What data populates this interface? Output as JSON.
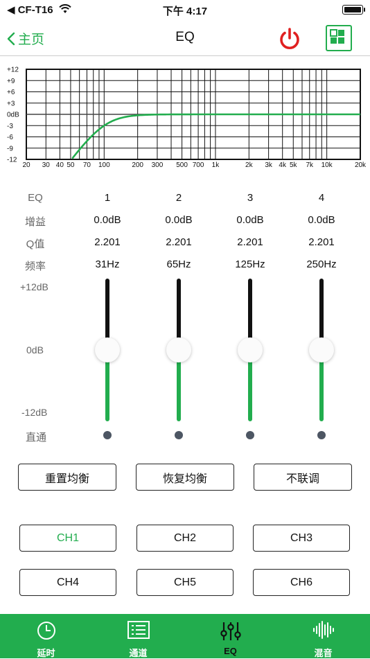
{
  "status_bar": {
    "carrier": "CF-T16",
    "time": "下午 4:17"
  },
  "nav": {
    "back_label": "主页",
    "title": "EQ"
  },
  "graph": {
    "y_ticks": [
      "+12",
      "+9",
      "+6",
      "+3",
      "0dB",
      "-3",
      "-6",
      "-9",
      "-12"
    ],
    "x_ticks": [
      "20",
      "30",
      "40",
      "50",
      "70",
      "100",
      "200",
      "300",
      "500",
      "700",
      "1k",
      "2k",
      "3k",
      "4k",
      "5k",
      "7k",
      "10k",
      "20k"
    ]
  },
  "table": {
    "header": {
      "label": "EQ",
      "bands": [
        "1",
        "2",
        "3",
        "4"
      ]
    },
    "gain": {
      "label": "增益",
      "values": [
        "0.0dB",
        "0.0dB",
        "0.0dB",
        "0.0dB"
      ]
    },
    "q": {
      "label": "Q值",
      "values": [
        "2.201",
        "2.201",
        "2.201",
        "2.201"
      ]
    },
    "freq": {
      "label": "频率",
      "values": [
        "31Hz",
        "65Hz",
        "125Hz",
        "250Hz"
      ]
    }
  },
  "sliders": {
    "top_label": "+12dB",
    "mid_label": "0dB",
    "bottom_label": "-12dB",
    "bypass_label": "直通",
    "gain_db": [
      0,
      0,
      0,
      0
    ]
  },
  "actions": {
    "reset": "重置均衡",
    "restore": "恢复均衡",
    "unlink": "不联调"
  },
  "channels": [
    "CH1",
    "CH2",
    "CH3",
    "CH4",
    "CH5",
    "CH6"
  ],
  "active_channel": "CH1",
  "tabs": [
    {
      "label": "延时",
      "icon": "clock-icon"
    },
    {
      "label": "通道",
      "icon": "list-icon"
    },
    {
      "label": "EQ",
      "icon": "sliders-icon"
    },
    {
      "label": "混音",
      "icon": "waveform-icon"
    }
  ],
  "colors": {
    "accent": "#22ad4e",
    "power": "#e02020",
    "dot": "#4d5663"
  }
}
